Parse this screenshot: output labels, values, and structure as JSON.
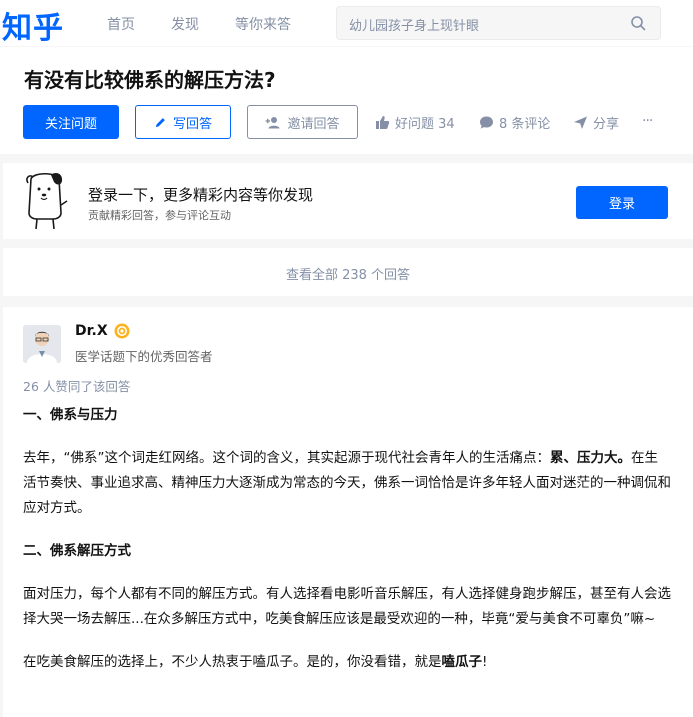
{
  "topbar": {
    "logo": "知乎",
    "nav": [
      "首页",
      "发现",
      "等你来答"
    ],
    "search_placeholder": "幼儿园孩子身上现针眼"
  },
  "question": {
    "title": "有没有比较佛系的解压方法?",
    "follow_label": "关注问题",
    "write_label": "写回答",
    "invite_label": "邀请回答",
    "good_question": "好问题 34",
    "comments": "8 条评论",
    "share": "分享",
    "more": "···"
  },
  "login": {
    "title": "登录一下，更多精彩内容等你发现",
    "subtitle": "贡献精彩回答，参与评论互动",
    "button": "登录"
  },
  "view_all": "查看全部 238 个回答",
  "answer": {
    "author": "Dr.X",
    "headline": "医学话题下的优秀回答者",
    "votes": "26 人赞同了该回答",
    "h1": "一、佛系与压力",
    "p1_a": "去年，“佛系”这个词走红网络。这个词的含义，其实起源于现代社会青年人的生活痛点：",
    "p1_b": "累、压力大。",
    "p1_c": "在生活节奏快、事业追求高、精神压力大逐渐成为常态的今天，佛系一词恰恰是许多年轻人面对迷茫的一种调侃和应对方式。",
    "h2": "二、佛系解压方式",
    "p2": "面对压力，每个人都有不同的解压方式。有人选择看电影听音乐解压，有人选择健身跑步解压，甚至有人会选择大哭一场去解压...在众多解压方式中，吃美食解压应该是最受欢迎的一种，毕竟“爱与美食不可辜负”嘛~",
    "p3_a": "在吃美食解压的选择上，不少人热衷于嗑瓜子。是的，你没看错，就是",
    "p3_b": "嗑瓜子",
    "p3_c": "!"
  },
  "colors": {
    "brand": "#0066ff",
    "muted": "#8590a6"
  }
}
